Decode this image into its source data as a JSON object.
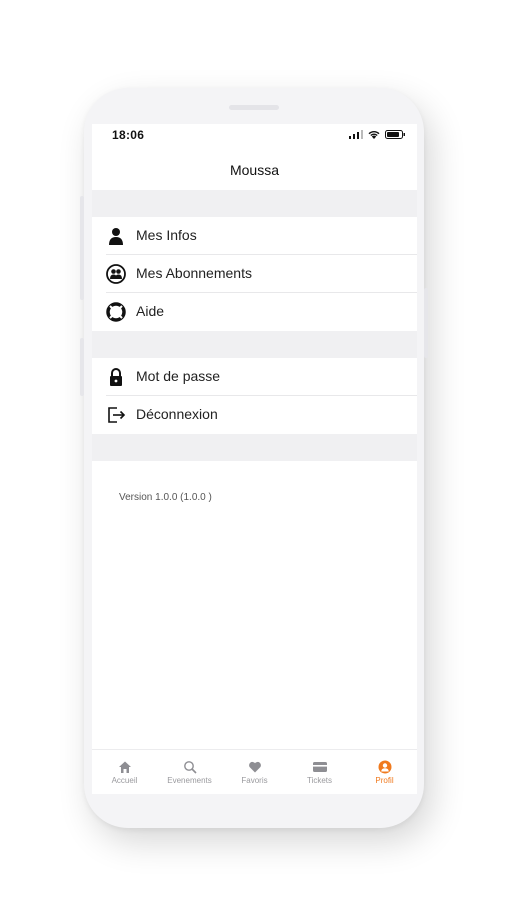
{
  "status": {
    "time": "18:06"
  },
  "header": {
    "title": "Moussa"
  },
  "menu_group_1": [
    {
      "label": "Mes Infos",
      "icon": "person-icon"
    },
    {
      "label": "Mes Abonnements",
      "icon": "group-icon"
    },
    {
      "label": "Aide",
      "icon": "lifebuoy-icon"
    }
  ],
  "menu_group_2": [
    {
      "label": "Mot de passe",
      "icon": "lock-icon"
    },
    {
      "label": "Déconnexion",
      "icon": "logout-icon"
    }
  ],
  "version": "Version 1.0.0 (1.0.0 )",
  "tabs": [
    {
      "label": "Accueil",
      "icon": "home-icon"
    },
    {
      "label": "Evenements",
      "icon": "search-icon"
    },
    {
      "label": "Favoris",
      "icon": "heart-icon"
    },
    {
      "label": "Tickets",
      "icon": "ticket-icon"
    },
    {
      "label": "Profil",
      "icon": "profile-icon",
      "active": true
    }
  ],
  "colors": {
    "accent": "#f07a1e",
    "background": "#f0f0f2"
  }
}
